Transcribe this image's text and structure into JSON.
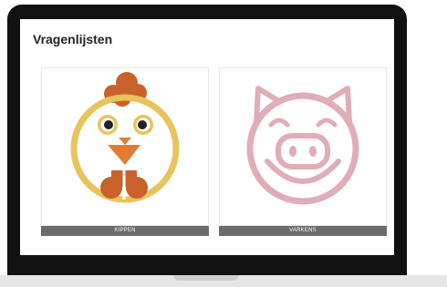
{
  "page": {
    "title": "Vragenlijsten"
  },
  "cards": [
    {
      "label": "KIPPEN",
      "icon": "chicken-icon"
    },
    {
      "label": "VARKENS",
      "icon": "pig-icon"
    }
  ],
  "colors": {
    "chicken_ring": "#e8c45c",
    "chicken_comb": "#c8622a",
    "chicken_beak": "#e07d33",
    "pig": "#e0adb8",
    "label_bg": "#6b6b6b"
  }
}
